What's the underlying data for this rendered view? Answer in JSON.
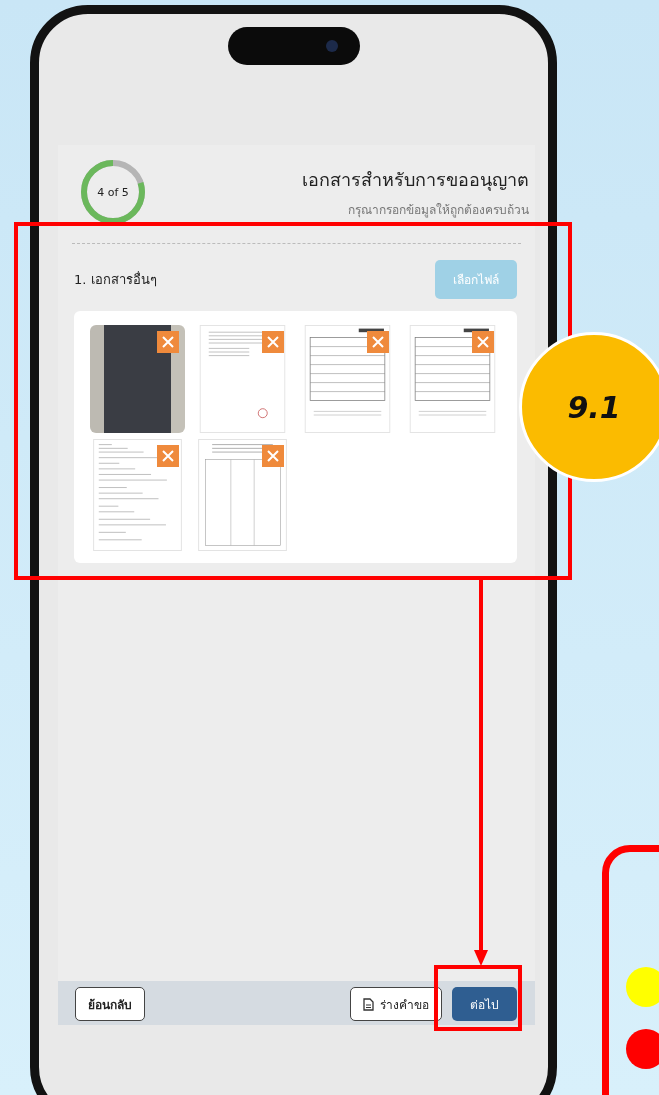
{
  "step": {
    "label": "4 of 5",
    "level": 0.8
  },
  "header": {
    "title": "เอกสารสำหรับการขออนุญาต",
    "subtitle": "กรุณากรอกข้อมูลให้ถูกต้องครบถ้วน"
  },
  "section": {
    "title": "1. เอกสารอื่นๆ",
    "button": "เลือกไฟล์"
  },
  "attachments": [
    {
      "kind": "photo"
    },
    {
      "kind": "letter"
    },
    {
      "kind": "form"
    },
    {
      "kind": "form"
    },
    {
      "kind": "list"
    },
    {
      "kind": "table"
    }
  ],
  "footer": {
    "back": "ย้อนกลับ",
    "draft": "ร่างคำขอ",
    "next": "ต่อไป"
  },
  "callout": {
    "label": "9.1"
  },
  "legend_dots": [
    {
      "color": "#ffff00"
    },
    {
      "color": "#ff0000"
    }
  ]
}
